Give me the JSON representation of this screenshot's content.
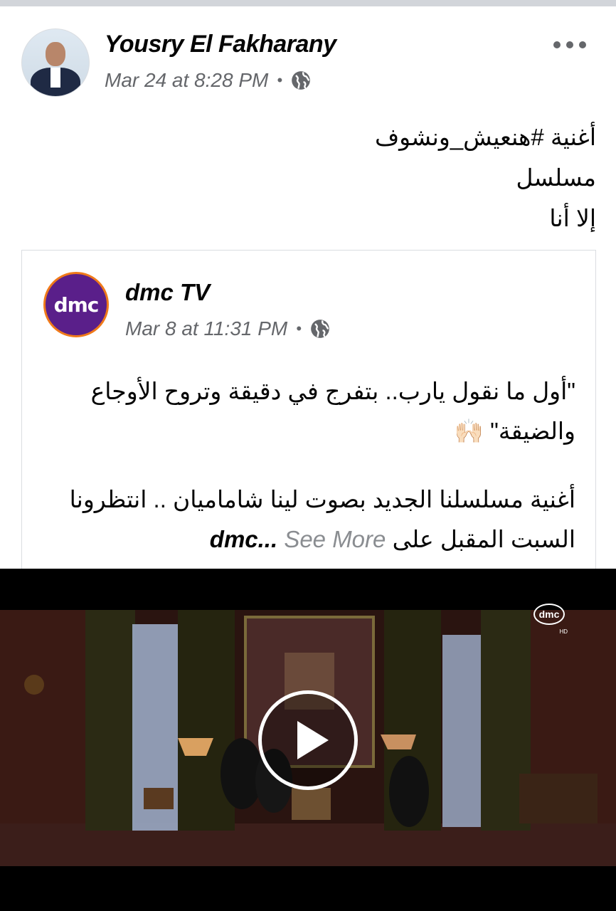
{
  "post": {
    "author": "Yousry El Fakharany",
    "timestamp": "Mar 24 at 8:28 PM",
    "separator": "•",
    "privacy_icon": "globe-icon",
    "more_icon": "more-dots-icon",
    "lines": [
      "أغنية #هنعيش_ونشوف",
      "مسلسل",
      "إلا أنا"
    ]
  },
  "shared": {
    "page_name": "dmc TV",
    "logo_text": "dmc",
    "timestamp": "Mar 8 at 11:31 PM",
    "separator": "•",
    "privacy_icon": "globe-icon",
    "quote_line1": "\"أول ما نقول يارب.. بتفرج في دقيقة وتروح الأوجاع",
    "quote_line2": "والضيقة\" 🙌🏻",
    "body_line1": "أغنية مسلسلنا الجديد بصوت لينا شاماميان .. انتظرونا",
    "body_line2": "السبت المقبل على",
    "channel": "dmc...",
    "see_more": "See More"
  },
  "video": {
    "watermark": "dmc",
    "watermark_hd": "HD",
    "play_icon": "play-icon",
    "colors": {
      "curtain": "#2b2a14",
      "wall": "#3a1a14",
      "window": "#9aa8c4"
    }
  }
}
